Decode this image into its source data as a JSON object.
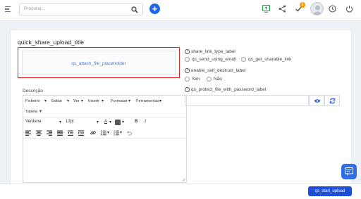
{
  "topbar": {
    "search_placeholder": "Procurar...",
    "notifications_count": "1"
  },
  "card": {
    "title": "quick_share_upload_title",
    "attach_placeholder": "qs_attach_file_placeholder"
  },
  "share_link": {
    "label": "share_link_type_label",
    "option_email": "qs_send_using_email",
    "option_link": "qs_get_sharable_link"
  },
  "self_destruct": {
    "label": "enable_self_destruct_label",
    "option_yes": "Sim",
    "option_no": "Não"
  },
  "password": {
    "label": "qs_protect_file_with_password_label",
    "value": ""
  },
  "description": {
    "label": "Descrição",
    "menu": [
      "Ficheiro",
      "Editar",
      "Ver",
      "Inserir",
      "Formatar",
      "Ferramentas",
      "Tabela"
    ],
    "font": "Verdana",
    "size": "12pt"
  },
  "footer": {
    "start_label": "qs_start_upload"
  },
  "colors": {
    "accent": "#1d4ed8",
    "highlight_border": "#e02424"
  }
}
